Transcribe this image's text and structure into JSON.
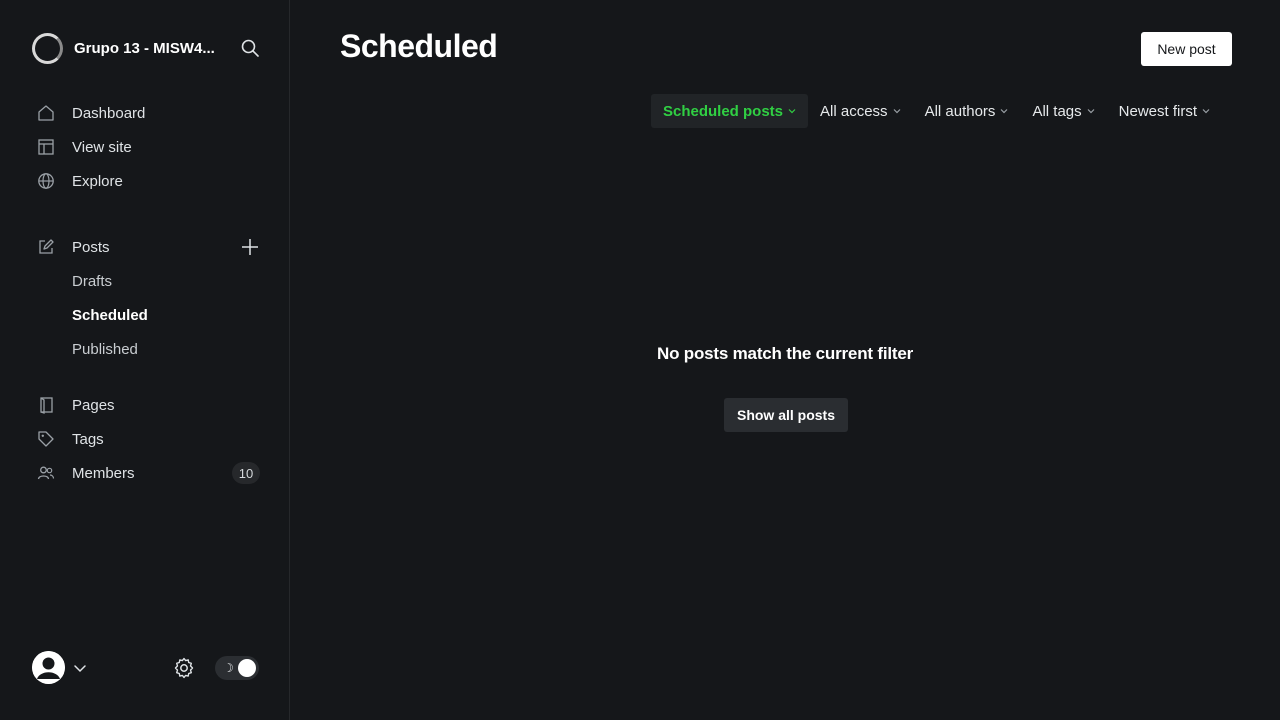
{
  "sidebar": {
    "site_name": "Grupo 13 - MISW4...",
    "nav": [
      {
        "label": "Dashboard",
        "icon": "home-icon"
      },
      {
        "label": "View site",
        "icon": "layout-icon"
      },
      {
        "label": "Explore",
        "icon": "globe-icon"
      }
    ],
    "posts": {
      "label": "Posts",
      "sub": [
        "Drafts",
        "Scheduled",
        "Published"
      ],
      "active": "Scheduled"
    },
    "content": [
      {
        "label": "Pages",
        "icon": "page-icon"
      },
      {
        "label": "Tags",
        "icon": "tag-icon"
      },
      {
        "label": "Members",
        "icon": "members-icon",
        "count": "10"
      }
    ],
    "footer": {
      "theme_mode": "dark"
    }
  },
  "main": {
    "title": "Scheduled",
    "new_post_label": "New post",
    "filters": [
      {
        "label": "Scheduled posts",
        "active": true
      },
      {
        "label": "All access",
        "active": false
      },
      {
        "label": "All authors",
        "active": false
      },
      {
        "label": "All tags",
        "active": false
      },
      {
        "label": "Newest first",
        "active": false
      }
    ],
    "empty_message": "No posts match the current filter",
    "show_all_label": "Show all posts"
  },
  "colors": {
    "background": "#15171a",
    "accent_green": "#30cf43",
    "text": "#e6e9eb"
  }
}
